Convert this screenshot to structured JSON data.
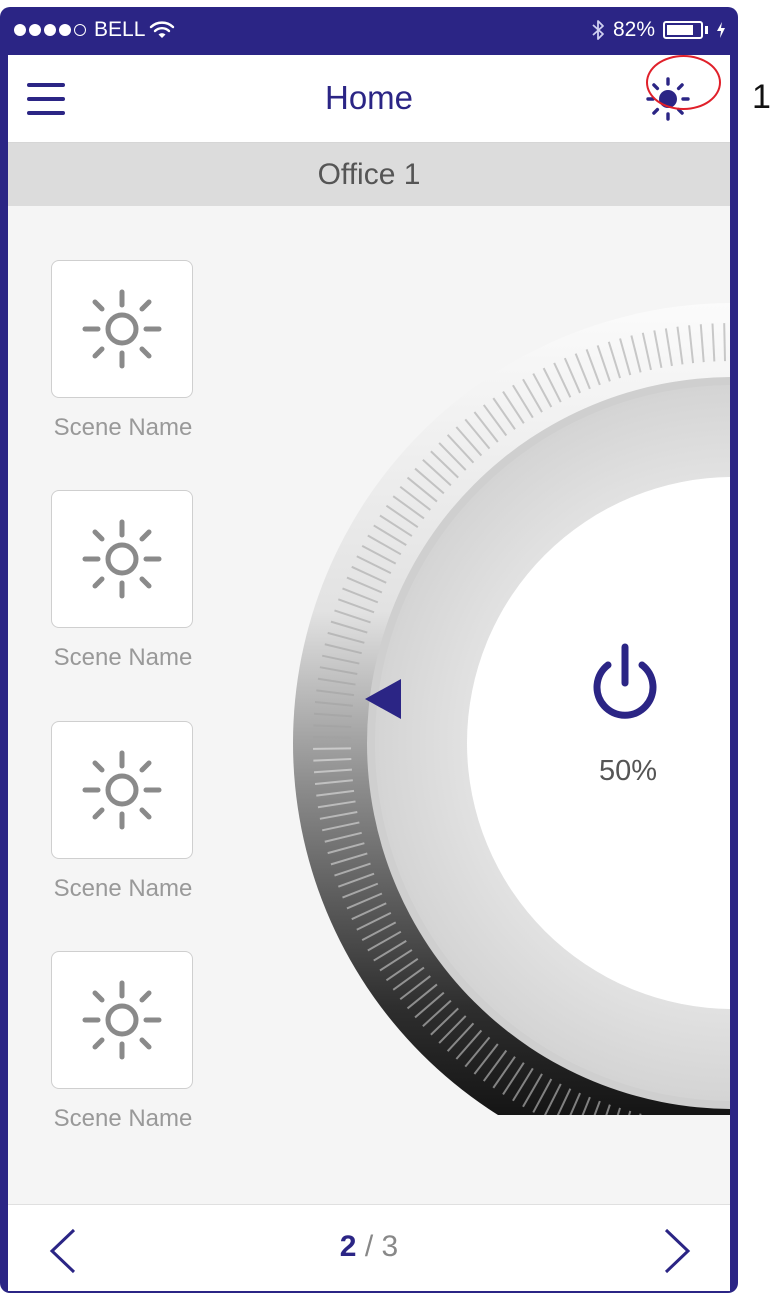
{
  "status_bar": {
    "carrier": "BELL",
    "signal_bars_filled": 4,
    "signal_bars_total": 5,
    "bluetooth_icon": "bluetooth-icon",
    "battery_text": "82%",
    "battery_level": 0.82
  },
  "header": {
    "title": "Home",
    "menu_icon": "hamburger-menu-icon",
    "brightness_icon": "brightness-icon"
  },
  "room": {
    "name": "Office 1"
  },
  "scenes": [
    {
      "label": "Scene Name",
      "icon": "sun-icon"
    },
    {
      "label": "Scene Name",
      "icon": "sun-icon"
    },
    {
      "label": "Scene Name",
      "icon": "sun-icon"
    },
    {
      "label": "Scene Name",
      "icon": "sun-icon"
    }
  ],
  "dimmer": {
    "level_text": "50%",
    "level": 0.5,
    "power_icon": "power-icon"
  },
  "pagination": {
    "current": "2",
    "separator": "/",
    "total": "3"
  },
  "annotation": {
    "number": "1"
  },
  "colors": {
    "accent": "#2b2585",
    "callout": "#e0202a",
    "scene_icon": "#8a8a8a"
  }
}
